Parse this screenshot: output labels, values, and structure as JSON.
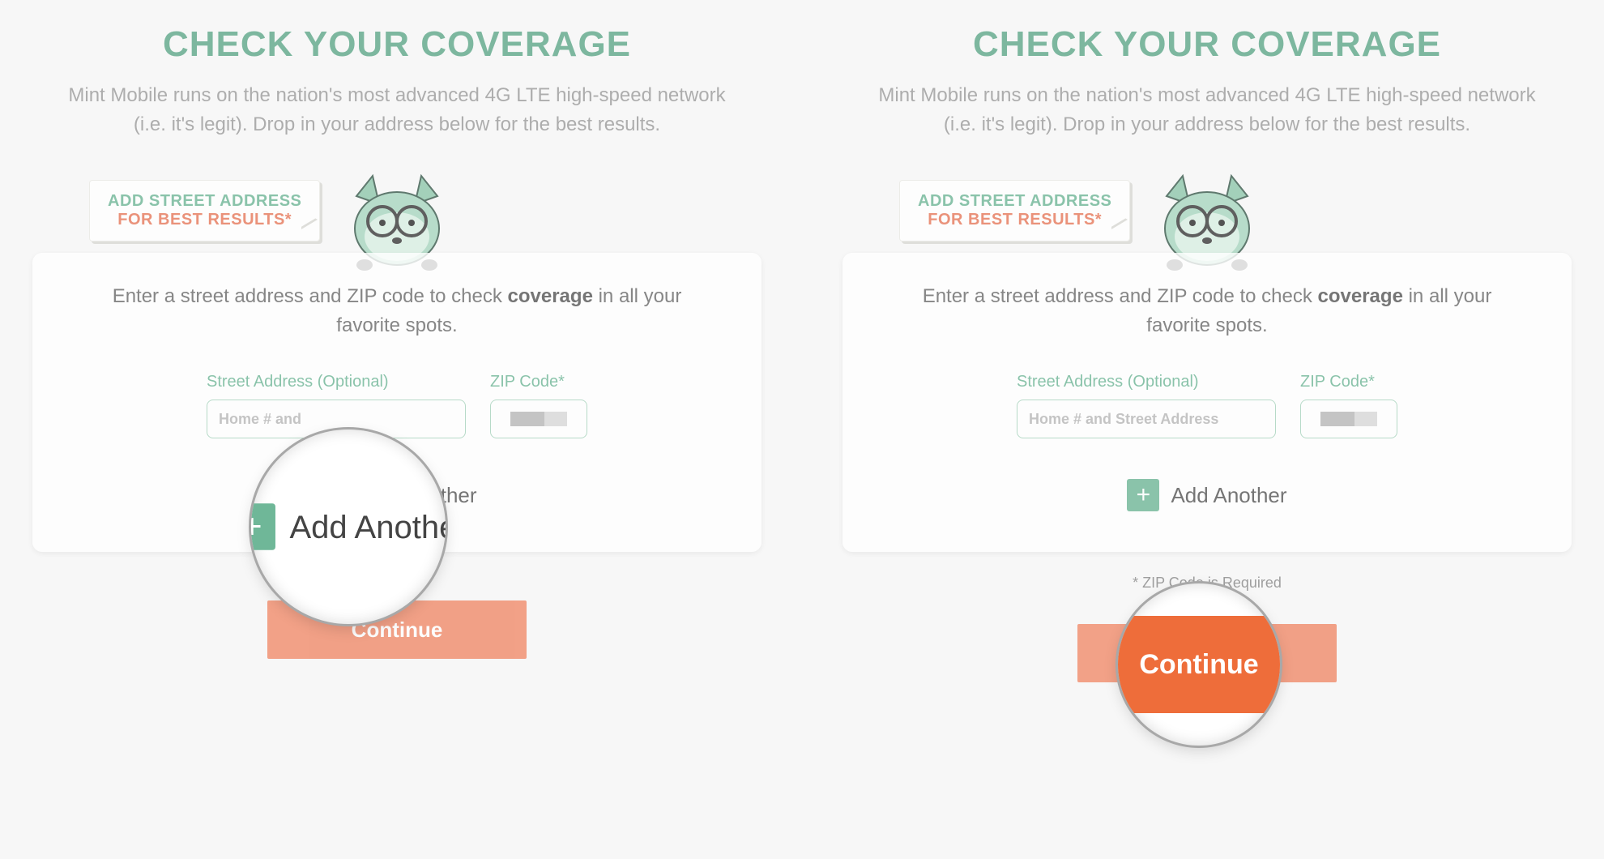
{
  "shared": {
    "title": "CHECK YOUR COVERAGE",
    "subtitle": "Mint Mobile runs on the nation's most advanced 4G LTE high-speed network (i.e. it's legit). Drop in your address below for the best results.",
    "bubble_line1": "ADD STREET ADDRESS",
    "bubble_line2": "FOR BEST RESULTS*",
    "card_instruction_prefix": "Enter a street address and ZIP code to check ",
    "card_instruction_bold": "coverage",
    "card_instruction_suffix": " in all your favorite spots.",
    "street_label": "Street Address (Optional)",
    "zip_label": "ZIP Code*",
    "street_placeholder": "Home # and Street Address",
    "add_another_label": "Add Another",
    "plus_glyph": "+",
    "continue_label": "Continue",
    "zip_required_note": "* ZIP Code is Required"
  },
  "left": {
    "show_disclaimer": false,
    "lens_focus": "add_another",
    "street_placeholder_short": "Home # and"
  },
  "right": {
    "show_disclaimer": true,
    "lens_focus": "continue"
  },
  "colors": {
    "brand_green": "#6fb798",
    "brand_orange": "#f08b6a",
    "brand_orange_strong": "#ee6d3a"
  }
}
